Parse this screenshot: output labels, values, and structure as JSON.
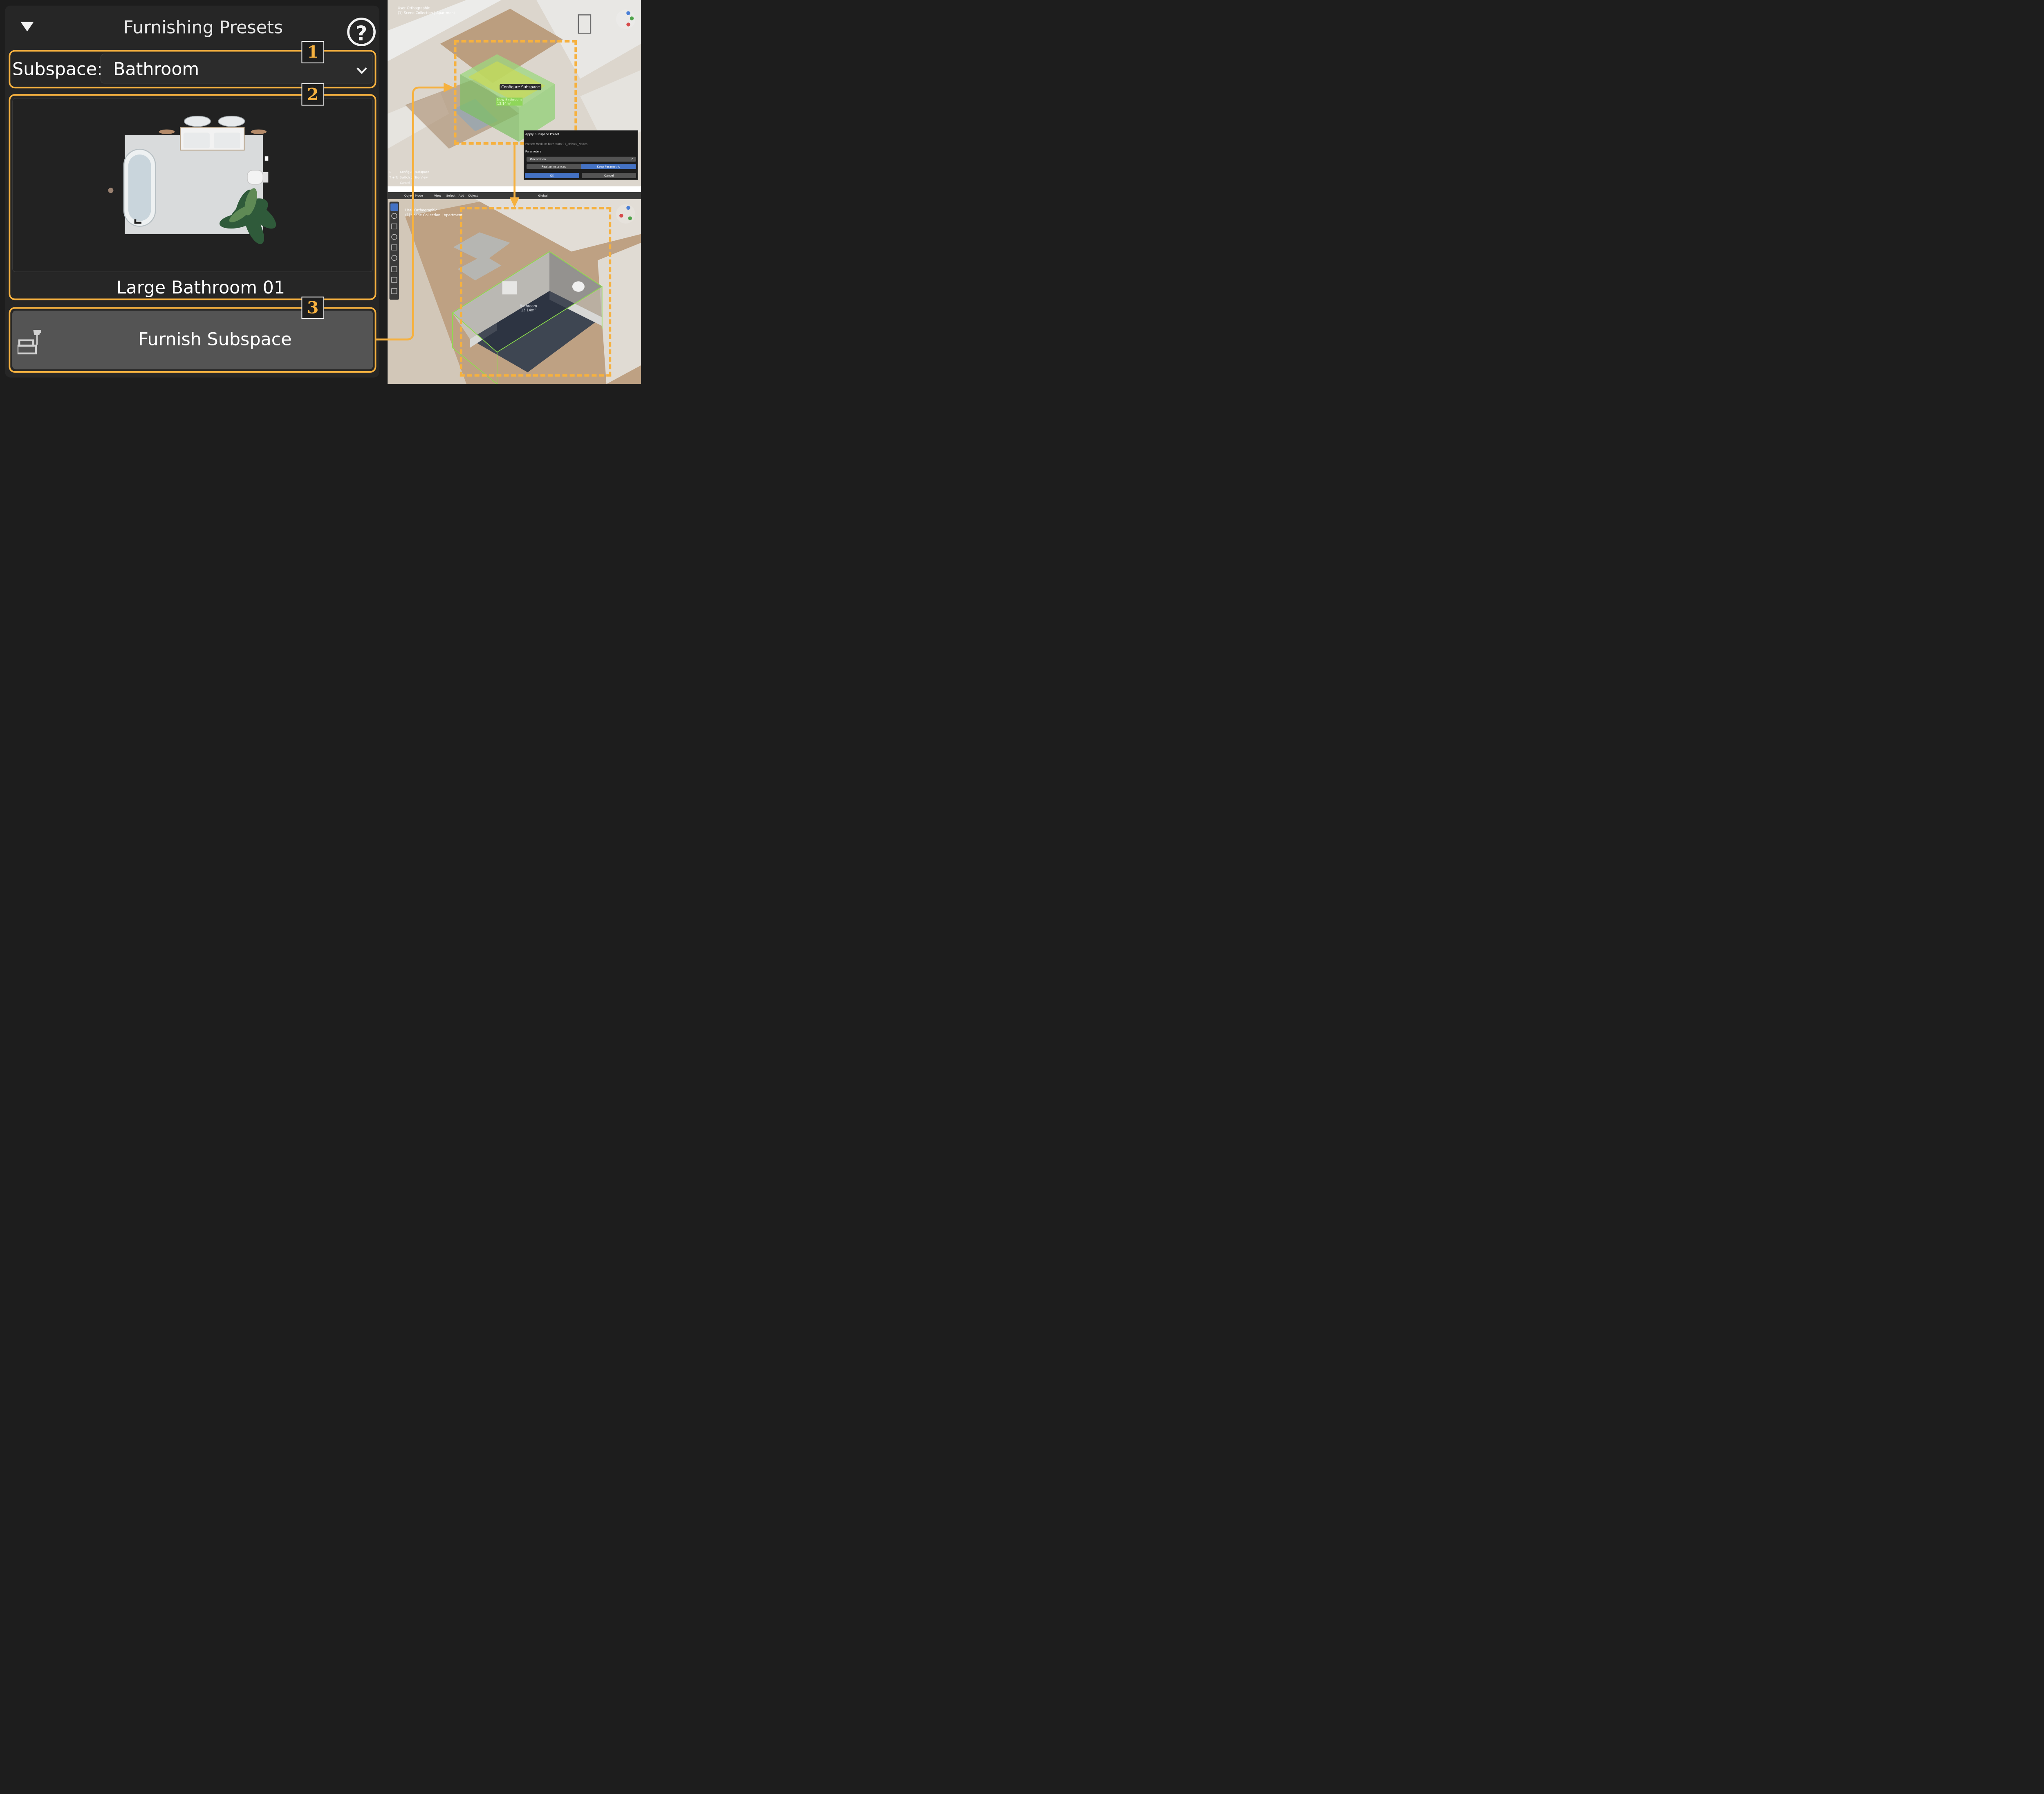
{
  "panel": {
    "title": "Furnishing Presets",
    "help_label": "?",
    "subspace_label": "Subspace:",
    "subspace_value": "Bathroom",
    "preset_name": "Large Bathroom 01",
    "furnish_button": "Furnish Subspace"
  },
  "badges": [
    "1",
    "2",
    "3"
  ],
  "viewport_top": {
    "view_name": "User Orthographic",
    "collection": "(1) Scene Collection | Apartment",
    "tooltip": "Configure Subspace",
    "room_label": "New Bathroom",
    "room_area": "13.14m²",
    "shortcuts": [
      {
        "key": "B:",
        "label": "Configure subspace"
      },
      {
        "key": "T + T:",
        "label": "Switch to Top View"
      },
      {
        "key": "",
        "label": "Cancel"
      }
    ],
    "dialog": {
      "title": "Apply Subspace Preset",
      "preset": "Preset: Medium Bathroom 01_aHhwu_Nodes",
      "section": "Parameters",
      "orientation_label": "Orientation",
      "orientation_value": "0",
      "realize_label": "Realize Instances",
      "keep_label": "Keep Parametric",
      "ok_label": "OK",
      "cancel_label": "Cancel"
    }
  },
  "viewport_bottom": {
    "menu": [
      "Object Mode",
      "View",
      "Select",
      "Add",
      "Object"
    ],
    "transform": "Global",
    "view_name": "User Orthographic",
    "collection": "(1) Scene Collection | Apartment",
    "room_label": "Bathroom",
    "room_area": "13.14m²"
  },
  "colors": {
    "accent_orange": "#f6b13f",
    "room_green": "#8bd06a",
    "dialog_blue": "#4472c4"
  }
}
